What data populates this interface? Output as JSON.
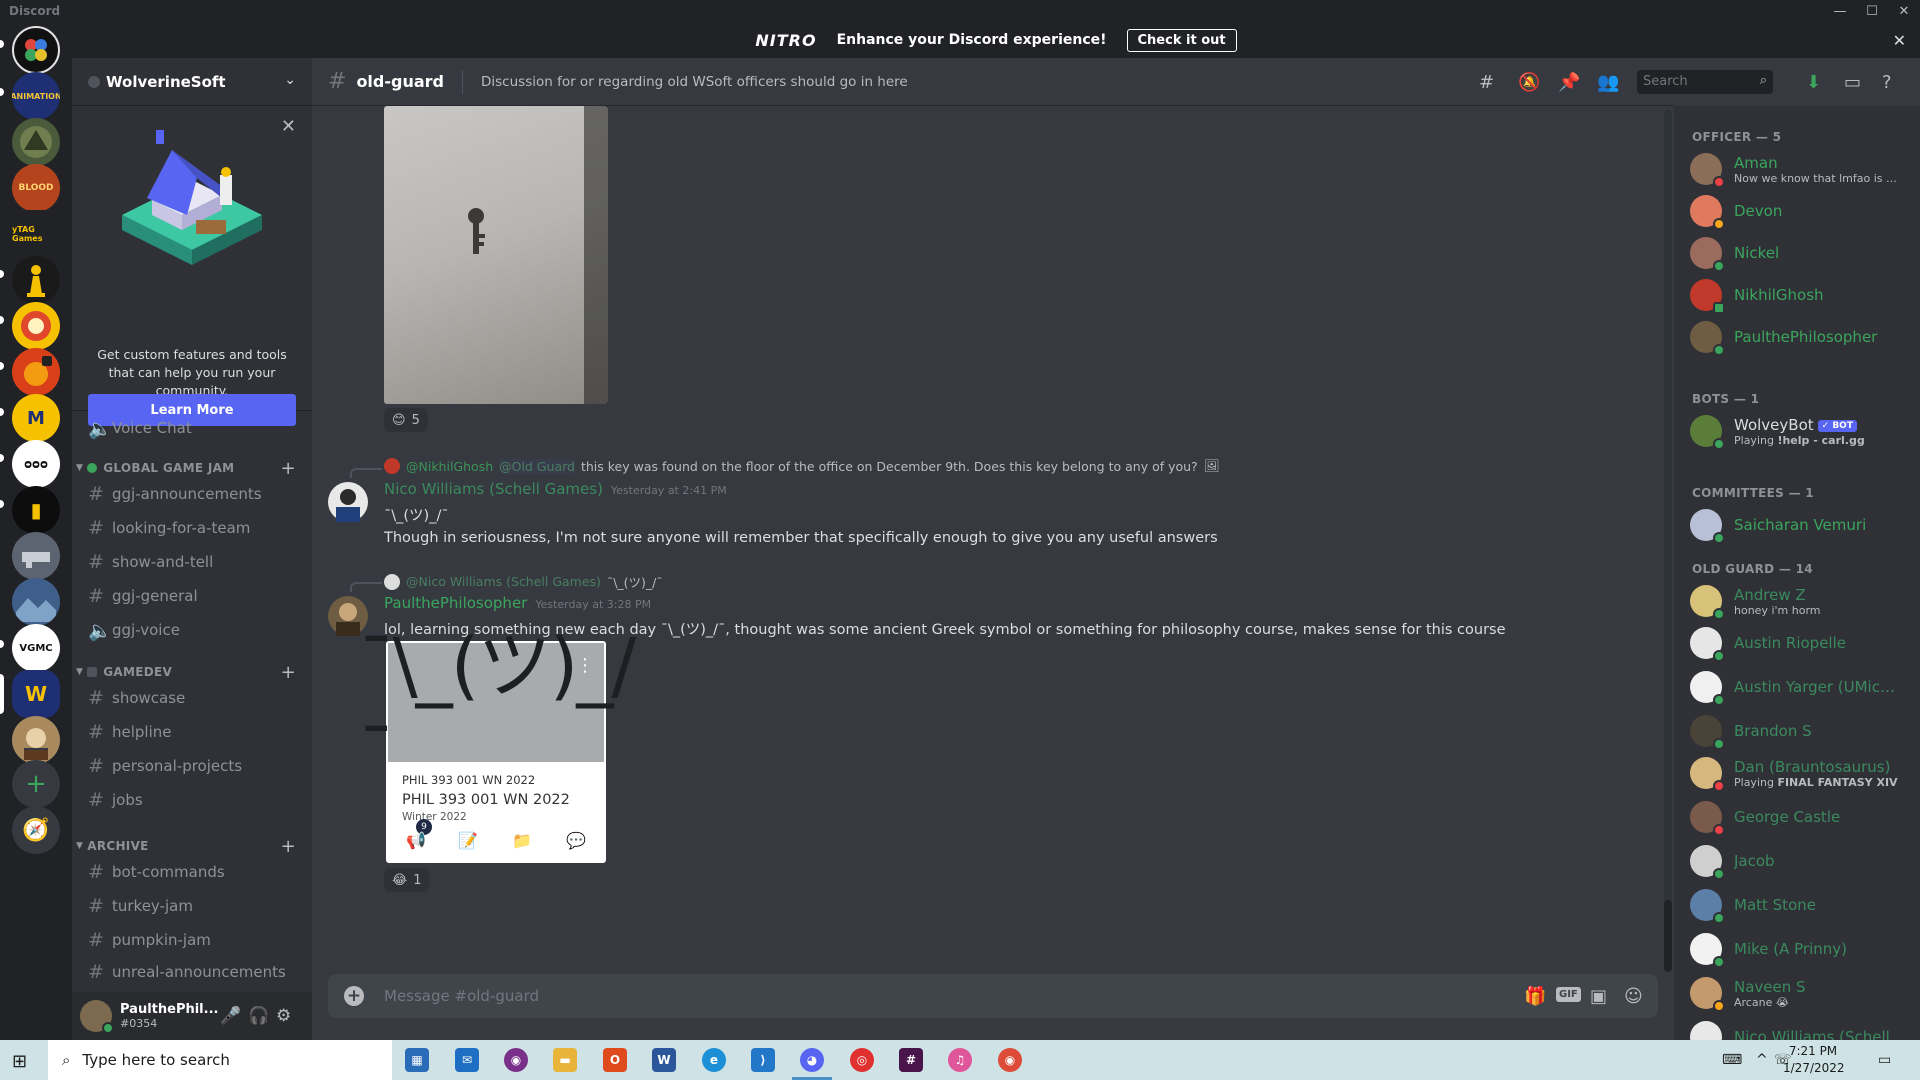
{
  "window": {
    "app_name": "Discord",
    "controls": [
      "—",
      "☐",
      "✕"
    ]
  },
  "nitro": {
    "logo": "NITRO",
    "text": "Enhance your Discord experience!",
    "cta": "Check it out",
    "close": "✕"
  },
  "server": {
    "name": "WolverineSoft"
  },
  "promo": {
    "description": "Get custom features and tools that can help you run your community.",
    "button": "Learn More"
  },
  "channels": {
    "voice_chat": "Voice Chat",
    "categories": [
      {
        "name": "GLOBAL GAME JAM",
        "channels": [
          "ggj-announcements",
          "looking-for-a-team",
          "show-and-tell",
          "ggj-general",
          "ggj-voice"
        ]
      },
      {
        "name": "GAMEDEV",
        "channels": [
          "showcase",
          "helpline",
          "personal-projects",
          "jobs"
        ]
      },
      {
        "name": "ARCHIVE",
        "channels": [
          "bot-commands",
          "turkey-jam",
          "pumpkin-jam",
          "unreal-announcements"
        ]
      }
    ]
  },
  "user": {
    "name": "PaulthePhil...",
    "tag": "#0354"
  },
  "chat": {
    "channel": "old-guard",
    "topic": "Discussion for or regarding old WSoft officers should go in here",
    "search_placeholder": "Search",
    "composer_placeholder": "Message #old-guard"
  },
  "messages": {
    "image_reaction": {
      "emoji": "😊",
      "count": "5"
    },
    "msg1": {
      "reply_mention": "@NikhilGhosh",
      "reply_role": "@Old Guard",
      "reply_text": "this key was found on the floor of the office on December 9th. Does this key belong to any of you?",
      "author": "Nico Williams (Schell Games)",
      "timestamp": "Yesterday at 2:41 PM",
      "line1": "¯\\_(ツ)_/¯",
      "line2": "Though in seriousness, I'm not sure anyone will remember that specifically enough to give you any useful answers"
    },
    "msg2": {
      "reply_mention": "@Nico Williams (Schell Games)",
      "reply_text": "¯\\_(ツ)_/¯",
      "author": "PaulthePhilosopher",
      "timestamp": "Yesterday at 3:28 PM",
      "line1": "lol, learning something new each day ¯\\_(ツ)_/¯, thought was some ancient Greek symbol or something for philosophy course, makes sense for this course"
    },
    "embed": {
      "hero": "¯\\_(ツ)_/¯",
      "course_small": "PHIL 393 001 WN 2022",
      "course_big": "PHIL 393 001 WN 2022",
      "term": "Winter 2022",
      "badge": "9"
    },
    "embed_reaction": {
      "emoji": "😂",
      "count": "1"
    }
  },
  "members": {
    "groups": {
      "officer": "OFFICER — 5",
      "bots": "BOTS — 1",
      "committees": "COMMITTEES — 1",
      "old_guard": "OLD GUARD — 14"
    },
    "officer": [
      {
        "name": "Aman",
        "status": "Now we know that lmfao is wo..."
      },
      {
        "name": "Devon"
      },
      {
        "name": "Nickel"
      },
      {
        "name": "NikhilGhosh"
      },
      {
        "name": "PaulthePhilosopher"
      }
    ],
    "bot": {
      "name": "WolveyBot",
      "badge": "✓ BOT",
      "status_prefix": "Playing",
      "status": "!help - carl.gg"
    },
    "committee": [
      {
        "name": "Saicharan Vemuri"
      }
    ],
    "old_guard": [
      {
        "name": "Andrew Z",
        "status": "honey i'm horm"
      },
      {
        "name": "Austin Riopelle"
      },
      {
        "name": "Austin Yarger (UMich ..."
      },
      {
        "name": "Brandon S"
      },
      {
        "name": "Dan (Brauntosaurus)",
        "status_prefix": "Playing",
        "status": "FINAL FANTASY XIV"
      },
      {
        "name": "George Castle"
      },
      {
        "name": "Jacob"
      },
      {
        "name": "Matt Stone"
      },
      {
        "name": "Mike (A Prinny)"
      },
      {
        "name": "Naveen S",
        "status": "Arcane 😭"
      },
      {
        "name": "Nico Williams (Schell"
      }
    ]
  },
  "taskbar": {
    "search_placeholder": "Type here to search",
    "time": "7:21 PM",
    "date": "1/27/2022"
  },
  "colors": {
    "accent": "#5865f2",
    "online": "#3ba55d",
    "officer": "#3ba55d",
    "background": "#36393f"
  }
}
